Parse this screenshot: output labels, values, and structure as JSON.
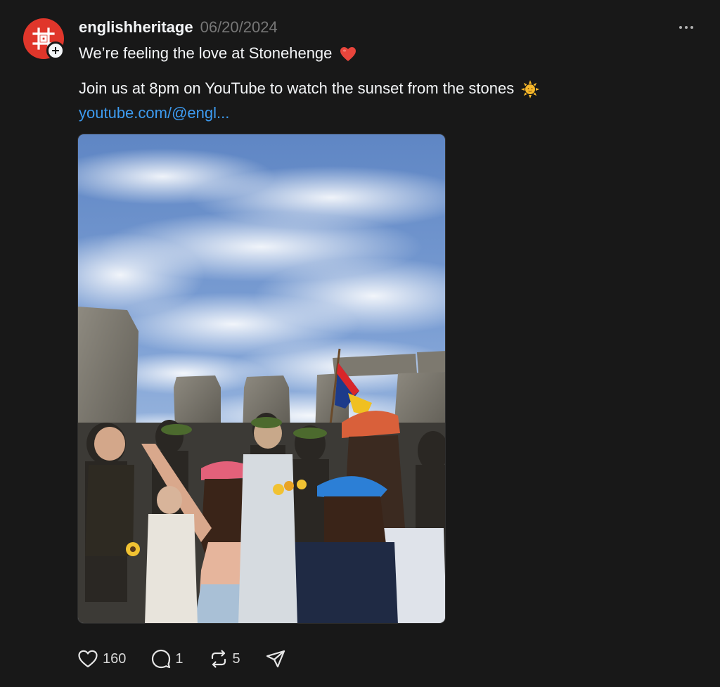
{
  "post": {
    "username": "englishheritage",
    "date": "06/20/2024",
    "line1": "We’re feeling the love at Stonehenge",
    "line1_emoji": "heart-emoji",
    "line2": "Join us at 8pm on YouTube to watch the sunset from the stones",
    "line2_emoji": "sun-emoji",
    "link": "youtube.com/@engl...",
    "image_alt": "Crowd celebrating at Stonehenge under a blue sky with clouds"
  },
  "actions": {
    "likes": "160",
    "replies": "1",
    "reposts": "5"
  },
  "icons": {
    "like": "heart-outline-icon",
    "reply": "comment-bubble-icon",
    "repost": "repost-icon",
    "share": "send-icon",
    "more": "more-dots-icon",
    "follow": "plus-icon"
  },
  "colors": {
    "background": "#181818",
    "text": "#f3f5f7",
    "muted": "#777777",
    "link": "#3d9bf0",
    "brand": "#e0362b"
  }
}
